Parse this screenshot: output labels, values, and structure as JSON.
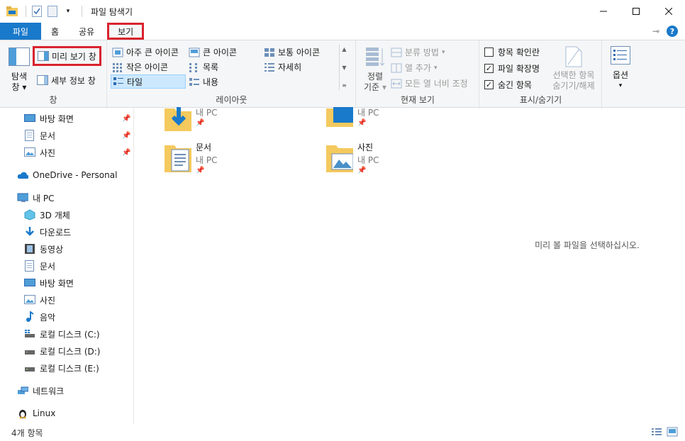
{
  "window": {
    "title": "파일 탐색기"
  },
  "tabs": {
    "file": "파일",
    "home": "홈",
    "share": "공유",
    "view": "보기"
  },
  "ribbon": {
    "pane": {
      "label": "창",
      "nav_pane": "탐색\n창",
      "nav_pane_line1": "탐색",
      "nav_pane_line2": "창",
      "preview_pane": "미리 보기 창",
      "details_pane": "세부 정보 창"
    },
    "layout": {
      "label": "레이아웃",
      "extra_large": "아주 큰 아이콘",
      "large": "큰 아이콘",
      "medium": "보통 아이콘",
      "small": "작은 아이콘",
      "list": "목록",
      "details": "자세히",
      "tiles": "타일",
      "content": "내용"
    },
    "current_view": {
      "label": "현재 보기",
      "sort_line1": "정렬",
      "sort_line2": "기준",
      "group_by": "분류 방법",
      "add_columns": "열 추가",
      "fit_columns": "모든 열 너비 조정"
    },
    "show_hide": {
      "label": "표시/숨기기",
      "item_checkboxes": "항목 확인란",
      "file_extensions": "파일 확장명",
      "hidden_items": "숨긴 항목",
      "hide_selected_line1": "선택한 항목",
      "hide_selected_line2": "숨기기/해제"
    },
    "options": {
      "label": "옵션"
    }
  },
  "nav": {
    "quick_access": [
      {
        "label": "바탕 화면"
      },
      {
        "label": "문서"
      },
      {
        "label": "사진"
      }
    ],
    "onedrive": "OneDrive - Personal",
    "this_pc": "내 PC",
    "pc_items": [
      {
        "label": "3D 개체"
      },
      {
        "label": "다운로드"
      },
      {
        "label": "동영상"
      },
      {
        "label": "문서"
      },
      {
        "label": "바탕 화면"
      },
      {
        "label": "사진"
      },
      {
        "label": "음악"
      },
      {
        "label": "로컬 디스크 (C:)"
      },
      {
        "label": "로컬 디스크 (D:)"
      },
      {
        "label": "로컬 디스크 (E:)"
      }
    ],
    "network": "네트워크",
    "linux": "Linux"
  },
  "content": {
    "tiles": [
      {
        "name": "",
        "sub": "내 PC",
        "icon": "download-folder-icon"
      },
      {
        "name": "",
        "sub": "내 PC",
        "icon": "desktop-folder-icon"
      },
      {
        "name": "문서",
        "sub": "내 PC",
        "icon": "documents-folder-icon"
      },
      {
        "name": "사진",
        "sub": "내 PC",
        "icon": "pictures-folder-icon"
      }
    ]
  },
  "preview": {
    "message": "미리 볼 파일을 선택하십시오."
  },
  "status": {
    "count": "4개 항목"
  },
  "colors": {
    "accent": "#1979ca",
    "highlight": "#d9232e",
    "selection": "#cce8ff",
    "folder": "#f4c95d"
  }
}
